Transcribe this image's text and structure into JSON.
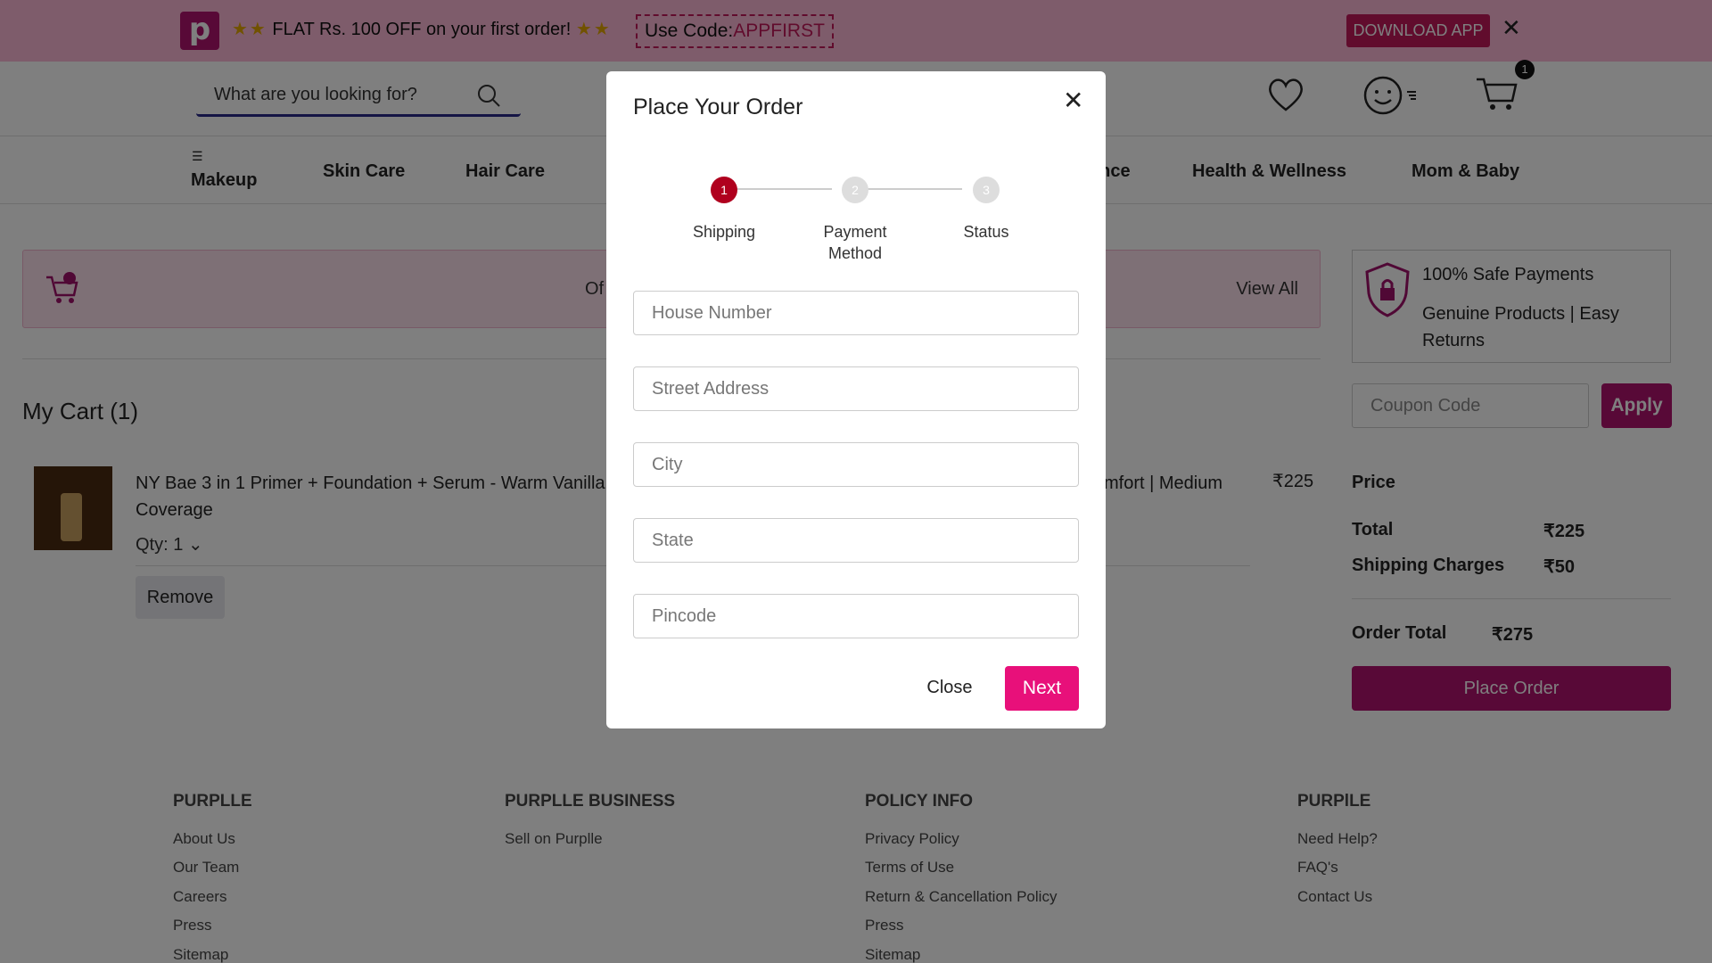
{
  "promo": {
    "logo": "p",
    "stars_left": "★★",
    "text": "FLAT Rs. 100 OFF on your first order!",
    "stars_right": "★★",
    "code_prefix": "Use Code:",
    "code": "APPFIRST",
    "download": "DOWNLOAD APP",
    "close_icon": "close-icon"
  },
  "header": {
    "search_placeholder": "What are you looking for?",
    "cart_count": "1",
    "icons": [
      "wishlist-heart-icon",
      "profile-icon",
      "cart-icon"
    ]
  },
  "nav": {
    "items": [
      "Makeup",
      "Skin Care",
      "Hair Care",
      "ance",
      "Health & Wellness",
      "Mom & Baby"
    ]
  },
  "offer": {
    "text": "Of",
    "view_all": "View All"
  },
  "cart": {
    "title": "My Cart (1)",
    "items": [
      {
        "name": "NY Bae 3 in 1 Primer + Foundation + Serum - Warm Vanilla (",
        "name_tail": "mfort | Medium",
        "name_line2": "Coverage",
        "price": "₹225",
        "qty": "Qty: 1",
        "remove": "Remove"
      }
    ]
  },
  "summary": {
    "safe_payments": "100% Safe Payments",
    "genuine": "Genuine Products | Easy Returns",
    "coupon_placeholder": "Coupon Code",
    "apply": "Apply",
    "price_heading": "Price",
    "total_label": "Total",
    "total_value": "₹225",
    "shipping_label": "Shipping Charges",
    "shipping_value": "₹50",
    "order_total_label": "Order Total",
    "order_total_value": "₹275",
    "place_order": "Place Order"
  },
  "footer": {
    "columns": [
      {
        "heading": "PURPLLE",
        "links": [
          "About Us",
          "Our Team",
          "Careers",
          "Press",
          "Sitemap"
        ]
      },
      {
        "heading": "PURPLLE BUSINESS",
        "links": [
          "Sell on Purplle"
        ]
      },
      {
        "heading": "POLICY INFO",
        "links": [
          "Privacy Policy",
          "Terms of Use",
          "Return & Cancellation Policy",
          "Press",
          "Sitemap"
        ]
      },
      {
        "heading": "PURPlLE",
        "links": [
          "Need Help?",
          "FAQ's",
          "Contact Us"
        ]
      }
    ]
  },
  "modal": {
    "title": "Place Your Order",
    "steps": [
      {
        "num": "1",
        "label": "Shipping"
      },
      {
        "num": "2",
        "label": "Payment Method"
      },
      {
        "num": "3",
        "label": "Status"
      }
    ],
    "active_step": 1,
    "fields": [
      "House Number",
      "Street Address",
      "City",
      "State",
      "Pincode"
    ],
    "close": "Close",
    "next": "Next",
    "accent_color": "#e8107a",
    "active_step_color": "#b0001e"
  }
}
